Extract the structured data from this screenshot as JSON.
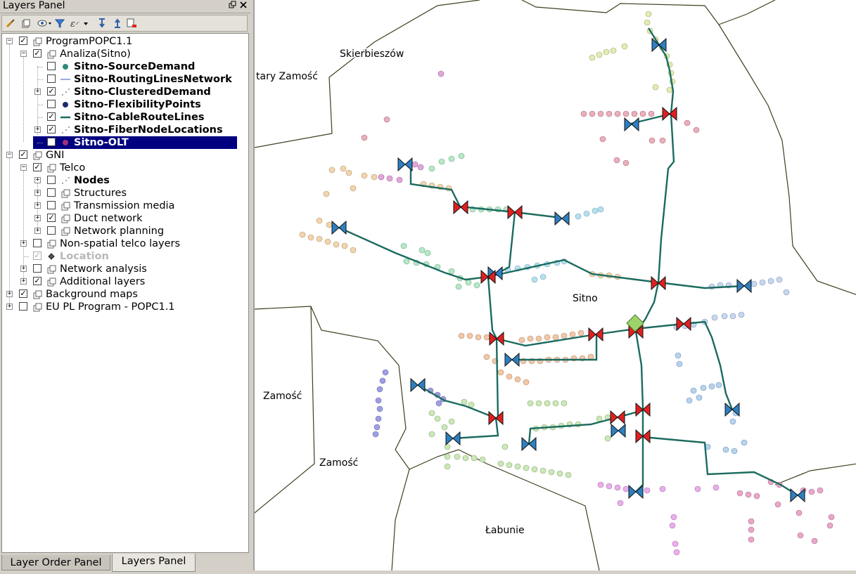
{
  "panel": {
    "title": "Layers Panel",
    "float_icon": "restore-icon",
    "close_icon": "close-icon",
    "toolbar": [
      "brush-icon",
      "add-group-icon",
      "eye-icon",
      "filter-icon",
      "expression-icon",
      "expand-all-icon",
      "collapse-all-icon",
      "remove-layer-icon"
    ]
  },
  "tree": {
    "items": [
      {
        "label": "ProgramPOPC1.1",
        "level": 0,
        "expander": "minus",
        "checked": true,
        "icon": "group",
        "bold": false
      },
      {
        "label": "Analiza(Sitno)",
        "level": 1,
        "expander": "minus",
        "checked": true,
        "icon": "group",
        "bold": false
      },
      {
        "label": "Sitno-SourceDemand",
        "level": 2,
        "expander": "",
        "checked": false,
        "icon": "dot-teal",
        "bold": true
      },
      {
        "label": "Sitno-RoutingLinesNetwork",
        "level": 2,
        "expander": "",
        "checked": false,
        "icon": "line-blue",
        "bold": true
      },
      {
        "label": "Sitno-ClusteredDemand",
        "level": 2,
        "expander": "plus",
        "checked": true,
        "icon": "dots",
        "bold": true
      },
      {
        "label": "Sitno-FlexibilityPoints",
        "level": 2,
        "expander": "",
        "checked": false,
        "icon": "dot-navy",
        "bold": true
      },
      {
        "label": "Sitno-CableRouteLines",
        "level": 2,
        "expander": "",
        "checked": true,
        "icon": "line-teal",
        "bold": true
      },
      {
        "label": "Sitno-FiberNodeLocations",
        "level": 2,
        "expander": "plus",
        "checked": true,
        "icon": "dots",
        "bold": true
      },
      {
        "label": "Sitno-OLT",
        "level": 2,
        "expander": "",
        "checked": false,
        "icon": "dot-purple",
        "bold": true,
        "selected": true
      },
      {
        "label": "GNI",
        "level": 0,
        "expander": "minus",
        "checked": true,
        "icon": "group",
        "bold": false
      },
      {
        "label": "Telco",
        "level": 1,
        "expander": "minus",
        "checked": true,
        "icon": "group",
        "bold": false
      },
      {
        "label": "Nodes",
        "level": 2,
        "expander": "plus",
        "checked": false,
        "icon": "dots",
        "bold": true
      },
      {
        "label": "Structures",
        "level": 2,
        "expander": "plus",
        "checked": false,
        "icon": "group",
        "bold": false
      },
      {
        "label": "Transmission media",
        "level": 2,
        "expander": "plus",
        "checked": false,
        "icon": "group",
        "bold": false
      },
      {
        "label": "Duct network",
        "level": 2,
        "expander": "plus",
        "checked": true,
        "icon": "group",
        "bold": false
      },
      {
        "label": "Network planning",
        "level": 2,
        "expander": "plus",
        "checked": false,
        "icon": "group",
        "bold": false
      },
      {
        "label": "Non-spatial telco layers",
        "level": 1,
        "expander": "plus",
        "checked": false,
        "icon": "group",
        "bold": false
      },
      {
        "label": "Location",
        "level": 1,
        "expander": "",
        "checked": true,
        "icon": "diamond",
        "bold": true,
        "disabled": true
      },
      {
        "label": "Network analysis",
        "level": 1,
        "expander": "plus",
        "checked": false,
        "icon": "group",
        "bold": false
      },
      {
        "label": "Additional layers",
        "level": 1,
        "expander": "plus",
        "checked": true,
        "icon": "group",
        "bold": false
      },
      {
        "label": "Background maps",
        "level": 0,
        "expander": "plus",
        "checked": true,
        "icon": "group",
        "bold": false
      },
      {
        "label": "EU PL Program - POPC1.1",
        "level": 0,
        "expander": "plus",
        "checked": false,
        "icon": "group",
        "bold": false
      }
    ]
  },
  "tabs": [
    {
      "label": "Layer Order Panel",
      "active": false
    },
    {
      "label": "Layers Panel",
      "active": true
    }
  ],
  "map": {
    "labels": [
      "Skierbieszów",
      "tary Zamość",
      "Sitno",
      "Zamość",
      "Zamość",
      "Łabunie"
    ],
    "colors": {
      "cable": "#1b6b5f",
      "boundary": "#3c3f1e",
      "fiber_node": "#2d7fc1",
      "splitter": "#e02020",
      "olt": "#9ed36a"
    }
  }
}
